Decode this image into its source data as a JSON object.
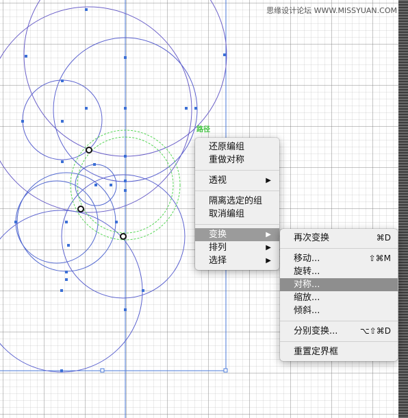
{
  "watermark": "思缘设计论坛  WWW.MISSYUAN.COM",
  "path_label": "路径",
  "context_menu": {
    "groups": [
      [
        {
          "label": "还原编组"
        },
        {
          "label": "重做对称"
        }
      ],
      [
        {
          "label": "透视",
          "submenu": true
        }
      ],
      [
        {
          "label": "隔离选定的组"
        },
        {
          "label": "取消编组"
        }
      ],
      [
        {
          "label": "变换",
          "submenu": true,
          "highlighted": true
        },
        {
          "label": "排列",
          "submenu": true
        },
        {
          "label": "选择",
          "submenu": true
        }
      ]
    ],
    "arrow_glyph": "▶"
  },
  "submenu": {
    "groups": [
      [
        {
          "label": "再次变换",
          "shortcut": "⌘D"
        }
      ],
      [
        {
          "label": "移动...",
          "shortcut": "⇧⌘M"
        },
        {
          "label": "旋转..."
        },
        {
          "label": "对称...",
          "highlighted": true
        },
        {
          "label": "缩放..."
        },
        {
          "label": "倾斜..."
        }
      ],
      [
        {
          "label": "分别变换...",
          "shortcut": "⌥⇧⌘D"
        }
      ],
      [
        {
          "label": "重置定界框"
        }
      ]
    ]
  },
  "colors": {
    "circle_stroke": "#6a5fc8",
    "selection_blue": "#3b6fd6",
    "green_path": "#55d655",
    "menu_highlight": "#9b9b9b"
  }
}
